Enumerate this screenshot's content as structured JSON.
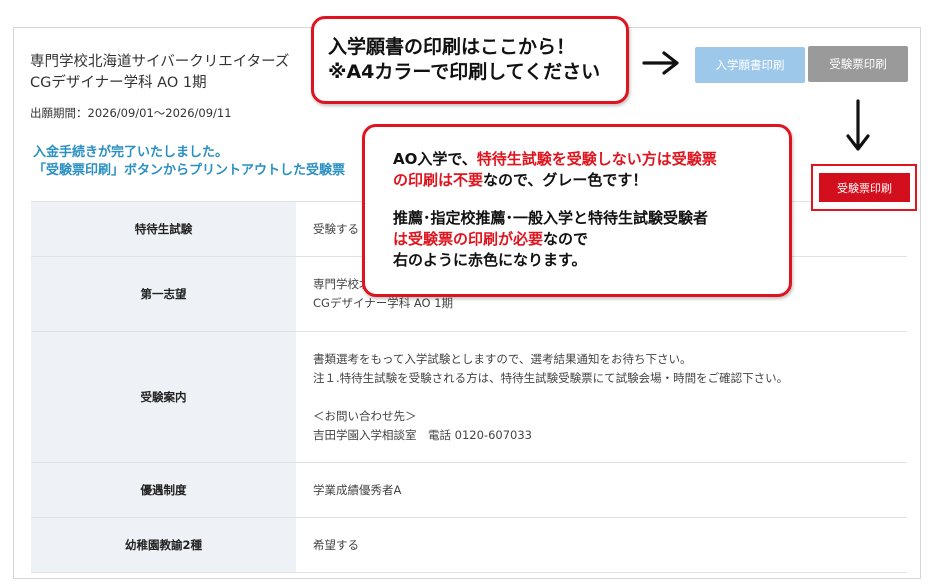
{
  "school": {
    "line1": "専門学校北海道サイバークリエイターズ",
    "line2": "CGデザイナー学科 AO 1期"
  },
  "period": "出願期間：2026/09/01〜2026/09/11",
  "notice": {
    "line1": "入金手続きが完了いたしました。",
    "line2": "「受験票印刷」ボタンからプリントアウトした受験票"
  },
  "buttons": {
    "application_print": "入学願書印刷",
    "exam_ticket_print_gray": "受験票印刷",
    "exam_ticket_print_red": "受験票印刷"
  },
  "table": [
    {
      "label": "特待生試験",
      "value": [
        "受験する"
      ]
    },
    {
      "label": "第一志望",
      "value": [
        "専門学校北海道サイバークリエイターズ",
        "CGデザイナー学科 AO 1期"
      ]
    },
    {
      "label": "受験案内",
      "value": [
        "書類選考をもって入学試験としますので、選考結果通知をお待ち下さい。",
        "注１.特待生試験を受験される方は、特待生試験受験票にて試験会場・時間をご確認下さい。",
        "",
        "＜お問い合わせ先＞",
        "吉田学園入学相談室　電話 0120-607033"
      ]
    },
    {
      "label": "優遇制度",
      "value": [
        "学業成績優秀者A"
      ]
    },
    {
      "label": "幼稚園教諭2種",
      "value": [
        "希望する"
      ]
    }
  ],
  "callout1": {
    "line1": "入学願書の印刷はここから！",
    "line2": "※A4カラーで印刷してください"
  },
  "callout2": {
    "l1a": "AO入学で、",
    "l1b": "特待生試験を受験しない方は受験票",
    "l2a": "の印刷は不要",
    "l2b": "なので、グレー色です！",
    "l3": "推薦･指定校推薦･一般入学と特待生試験受験者",
    "l4a": "は受験票の印刷が必要",
    "l4b": "なので",
    "l5": "右のように赤色になります。"
  },
  "colors": {
    "accent_red": "#e0141e",
    "notice_blue": "#2a8fc1",
    "app_button": "#9dc8ea",
    "gray_button": "#9a9a9a",
    "header_cell": "#eef2f6"
  }
}
